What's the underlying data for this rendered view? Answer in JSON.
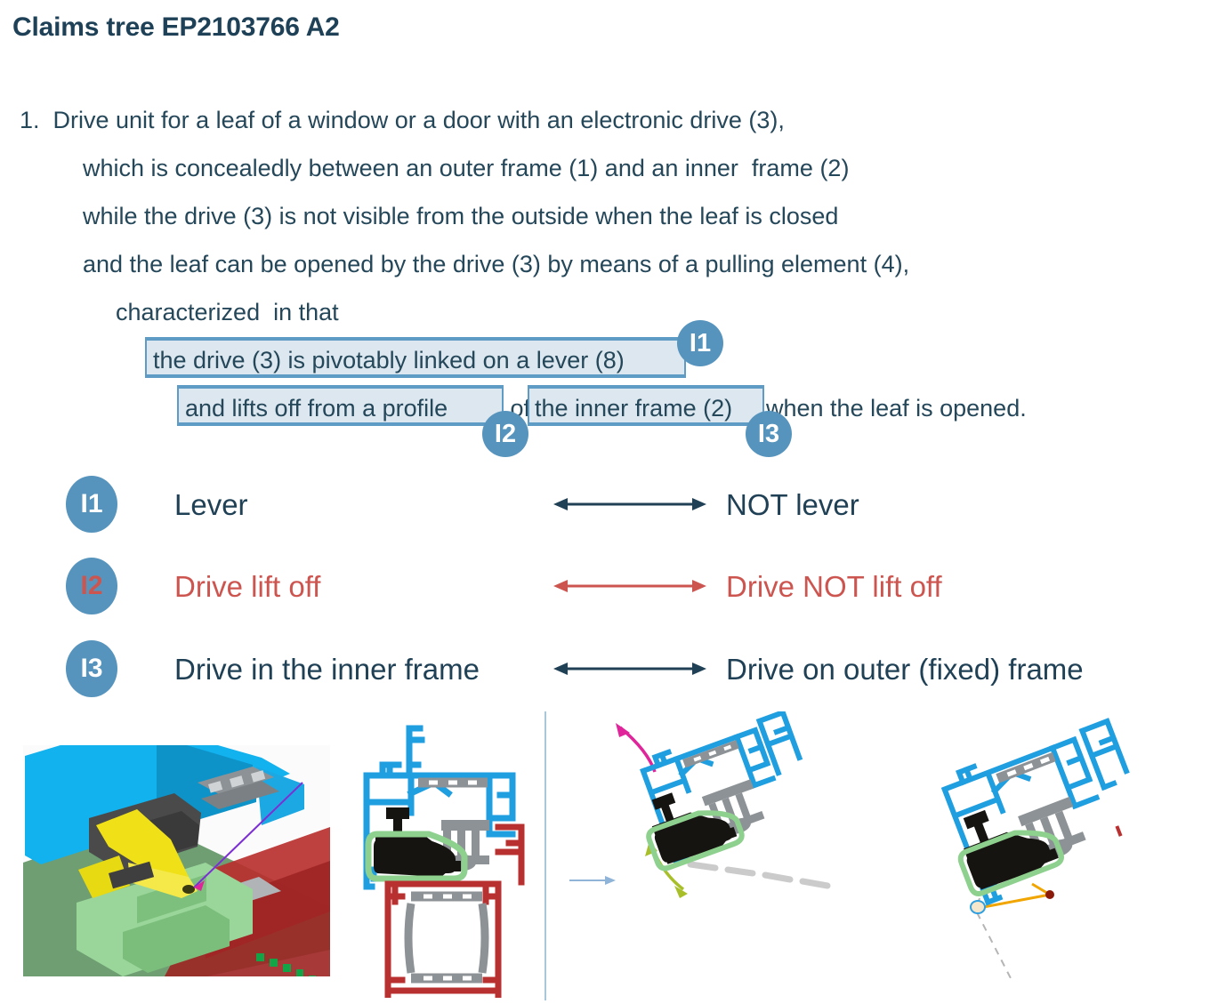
{
  "title": "Claims tree EP2103766 A2",
  "claim": {
    "lines": [
      "1.  Drive unit for a leaf of a window or a door with an electronic drive (3),",
      "which is concealedly between an outer frame (1) and an inner  frame (2)",
      "while the drive (3) is not visible from the outside when the leaf is closed",
      "and the leaf can be opened by the drive (3) by means of a pulling element (4),",
      "characterized  in that"
    ]
  },
  "highlights": {
    "box1_text": "the drive (3) is pivotably linked on a lever (8)",
    "box2_text": "and lifts off from a profile",
    "box2_tail": " of ",
    "box3_text": "the inner frame (2)",
    "box3_tail": "when the leaf is opened.",
    "badge1": "I1",
    "badge2": "I2",
    "badge3": "I3"
  },
  "legend": {
    "rows": [
      {
        "badge": "I1",
        "left": "Lever",
        "right": "NOT lever",
        "color": "#1f4055",
        "badge_text_color": "#ffffff"
      },
      {
        "badge": "I2",
        "left": "Drive lift off",
        "right": "Drive NOT lift off",
        "color": "#cd5550",
        "badge_text_color": "#cd5550"
      },
      {
        "badge": "I3",
        "left": "Drive in the inner frame",
        "right": "Drive on outer (fixed) frame",
        "color": "#1f4055",
        "badge_text_color": "#ffffff"
      }
    ]
  },
  "figures": {
    "fig1_name": "3D cutaway render of window frame profile with drive unit",
    "fig2_name": "2D cross-section of closed window with inner and outer frame",
    "fig3_name": "2D cross-section of opened tilted leaf with motion arrows",
    "fig4_name": "2D cross-section of tilted leaf with lever pivot geometry"
  },
  "colors": {
    "accent_blue": "#5694bd",
    "box_fill": "#dce7ef",
    "box_border": "#5f9cc5",
    "navy": "#1f4055",
    "red": "#cd5550",
    "frame_blue": "#1f9ee0",
    "frame_red": "#b8302f",
    "gray": "#8d9296",
    "green": "#8ed08e",
    "magenta": "#e0259b",
    "olive": "#a8bf2a",
    "orange": "#f0a500"
  }
}
